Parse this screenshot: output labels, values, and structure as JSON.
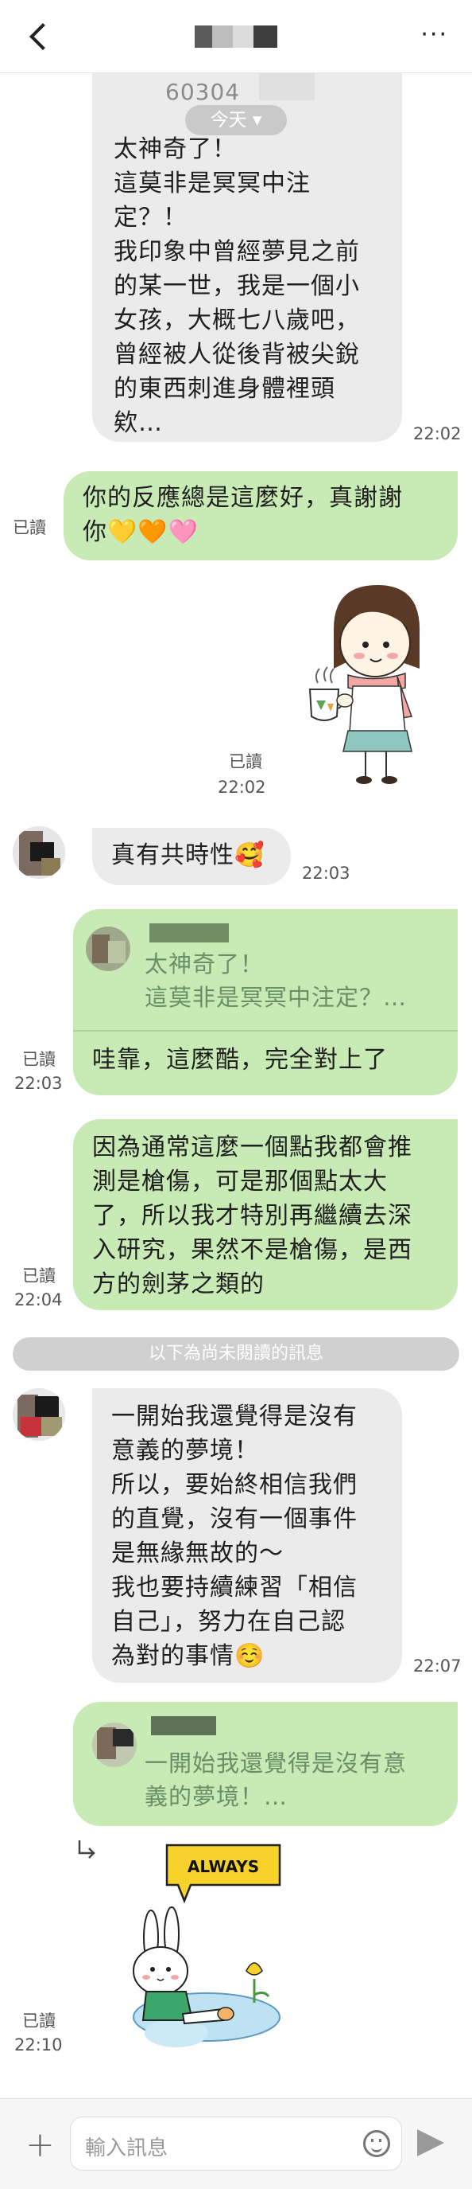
{
  "header": {
    "back_icon": "chevron-left-icon",
    "title": "",
    "more_icon": "more-dots-icon",
    "more_label": "···"
  },
  "messages": {
    "m1": {
      "partial_text": "60304",
      "text": "太神奇了！\n這莫非是冥冥中注\n定？！\n我印象中曾經夢見之前\n的某一世，我是一個小\n女孩，大概七八歲吧，\n曾經被人從後背被尖銳\n的東西刺進身體裡頭\n欸…",
      "time": "22:02"
    },
    "today_pill": "今天 ▾",
    "m2": {
      "text": "你的反應總是這麼好，真謝謝\n你💛🧡🩷",
      "read": "已讀"
    },
    "m3": {
      "sticker": "girl-holding-tea-sticker",
      "read": "已讀",
      "time": "22:02"
    },
    "m4": {
      "text": "真有共時性🥰",
      "time": "22:03"
    },
    "m5": {
      "quote": "太神奇了！\n這莫非是冥冥中注定？…",
      "text": "哇靠，這麼酷，完全對上了",
      "read": "已讀",
      "time": "22:03"
    },
    "m6": {
      "text": "因為通常這麼一個點我都會推\n測是槍傷，可是那個點太大\n了，所以我才特別再繼續去深\n入研究，果然不是槍傷，是西\n方的劍茅之類的",
      "read": "已讀",
      "time": "22:04"
    },
    "unread_divider": "以下為尚未閱讀的訊息",
    "m7": {
      "text": "一開始我還覺得是沒有\n意義的夢境！\n所以，要始終相信我們\n的直覺，沒有一個事件\n是無緣無故的～\n我也要持續練習「相信\n自己」，努力在自己認\n為對的事情☺️",
      "time": "22:07"
    },
    "m8": {
      "quote": "一開始我還覺得是沒有意\n義的夢境！…",
      "reply_icon": "reply-arrow-icon",
      "sticker_text": "ALWAYS",
      "read": "已讀",
      "time": "22:10"
    }
  },
  "composer": {
    "add_icon": "plus-icon",
    "placeholder": "輸入訊息",
    "emoji_icon": "smiley-icon",
    "send_icon": "send-icon"
  },
  "colors": {
    "incoming_bubble": "#ebebeb",
    "outgoing_bubble": "#c8eab5",
    "quote_text": "#6a8f67"
  }
}
